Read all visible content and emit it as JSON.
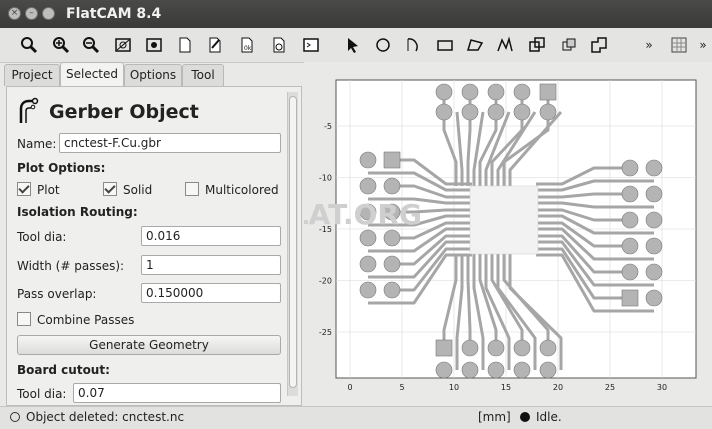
{
  "window": {
    "title": "FlatCAM 8.4"
  },
  "tabs": [
    "Project",
    "Selected",
    "Options",
    "Tool"
  ],
  "panel": {
    "object_title": "Gerber Object",
    "name_label": "Name:",
    "name_value": "cnctest-F.Cu.gbr",
    "plot_options_label": "Plot Options:",
    "plot_label": "Plot",
    "solid_label": "Solid",
    "multicolored_label": "Multicolored",
    "isolation_label": "Isolation Routing:",
    "tool_dia_label": "Tool dia:",
    "tool_dia_value": "0.016",
    "width_label": "Width (# passes):",
    "width_value": "1",
    "overlap_label": "Pass overlap:",
    "overlap_value": "0.150000",
    "combine_label": "Combine Passes",
    "generate_button": "Generate Geometry",
    "cutout_label": "Board cutout:",
    "cutout_tool_dia_label": "Tool dia:",
    "cutout_tool_dia_value": "0.07"
  },
  "checkboxes": {
    "plot": true,
    "solid": true,
    "multicolored": false,
    "combine": false
  },
  "toolbar_icons": [
    "zoom-fit-icon",
    "zoom-in-icon",
    "zoom-out-icon",
    "clear-plot-icon",
    "replot-icon",
    "new-geometry-icon",
    "edit-geometry-icon",
    "update-geometry-icon",
    "delete-icon",
    "shell-icon",
    "select-icon",
    "circle-icon",
    "arc-icon",
    "rectangle-icon",
    "polygon-icon",
    "path-icon",
    "move-icon",
    "copy-icon",
    "union-icon",
    "more-icon",
    "grid-icon",
    "more-icon-2"
  ],
  "plot": {
    "x_ticks": [
      "0",
      "5",
      "10",
      "15",
      "20",
      "25",
      "30"
    ],
    "y_ticks": [
      "-5",
      "-10",
      "-15",
      "-20",
      "-25"
    ],
    "watermark": "KAK-SDELAT.ORG",
    "trace_color": "#a6a6a6",
    "pad_color": "#b4b4b4"
  },
  "status": {
    "message": "Object deleted: cnctest.nc",
    "units": "[mm]",
    "state": "Idle."
  }
}
